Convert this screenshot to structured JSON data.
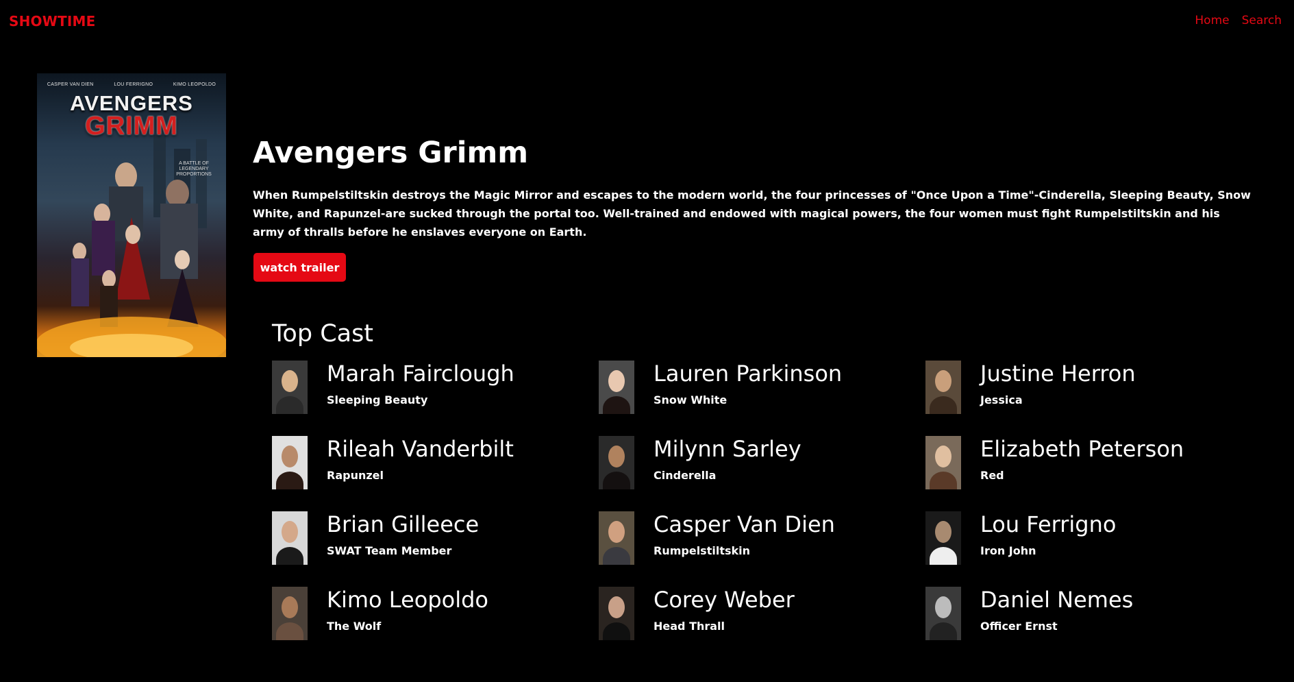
{
  "nav": {
    "brand": "SHOWTIME",
    "links": [
      "Home",
      "Search"
    ]
  },
  "poster": {
    "credits": [
      "CASPER VAN DIEN",
      "LOU FERRIGNO",
      "KIMO LEOPOLDO"
    ],
    "title_line1": "AVENGERS",
    "title_line2": "GRIMM",
    "tagline": "A BATTLE OF LEGENDARY PROPORTIONS"
  },
  "movie": {
    "title": "Avengers Grimm",
    "overview": "When Rumpelstiltskin destroys the Magic Mirror and escapes to the modern world, the four princesses of \"Once Upon a Time\"-Cinderella, Sleeping Beauty, Snow White, and Rapunzel-are sucked through the portal too. Well-trained and endowed with magical powers, the four women must fight Rumpelstiltskin and his army of thralls before he enslaves everyone on Earth.",
    "trailer_label": "watch trailer"
  },
  "cast": {
    "heading": "Top Cast",
    "members": [
      {
        "name": "Marah Fairclough",
        "role": "Sleeping Beauty"
      },
      {
        "name": "Lauren Parkinson",
        "role": "Snow White"
      },
      {
        "name": "Justine Herron",
        "role": "Jessica"
      },
      {
        "name": "Rileah Vanderbilt",
        "role": "Rapunzel"
      },
      {
        "name": "Milynn Sarley",
        "role": "Cinderella"
      },
      {
        "name": "Elizabeth Peterson",
        "role": "Red"
      },
      {
        "name": "Brian Gilleece",
        "role": "SWAT Team Member"
      },
      {
        "name": "Casper Van Dien",
        "role": "Rumpelstiltskin"
      },
      {
        "name": "Lou Ferrigno",
        "role": "Iron John"
      },
      {
        "name": "Kimo Leopoldo",
        "role": "The Wolf"
      },
      {
        "name": "Corey Weber",
        "role": "Head Thrall"
      },
      {
        "name": "Daniel Nemes",
        "role": "Officer Ernst"
      }
    ]
  },
  "colors": {
    "accent": "#e50914",
    "background": "#000000",
    "text": "#ffffff"
  }
}
